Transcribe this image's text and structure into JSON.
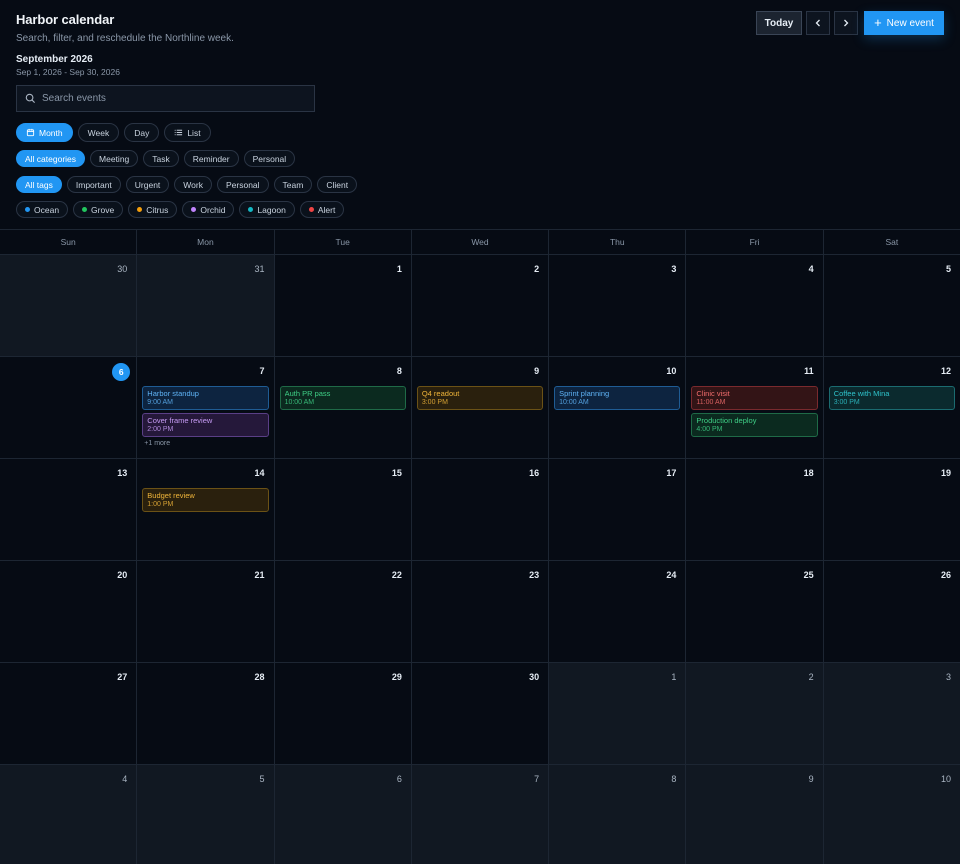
{
  "header": {
    "title": "Harbor calendar",
    "subtitle": "Search, filter, and reschedule the Northline week.",
    "month_title": "September 2026",
    "month_range": "Sep 1, 2026 - Sep 30, 2026"
  },
  "toolbar": {
    "today_label": "Today",
    "new_event_label": "New event"
  },
  "search": {
    "placeholder": "Search events",
    "value": ""
  },
  "views": [
    {
      "label": "Month",
      "active": true,
      "icon": "calendar-icon"
    },
    {
      "label": "Week",
      "active": false
    },
    {
      "label": "Day",
      "active": false
    },
    {
      "label": "List",
      "active": false,
      "icon": "list-icon"
    }
  ],
  "categories": [
    {
      "label": "All categories",
      "active": true
    },
    {
      "label": "Meeting",
      "active": false
    },
    {
      "label": "Task",
      "active": false
    },
    {
      "label": "Reminder",
      "active": false
    },
    {
      "label": "Personal",
      "active": false
    }
  ],
  "tags": [
    {
      "label": "All tags",
      "active": true
    },
    {
      "label": "Important",
      "active": false
    },
    {
      "label": "Urgent",
      "active": false
    },
    {
      "label": "Work",
      "active": false
    },
    {
      "label": "Personal",
      "active": false
    },
    {
      "label": "Team",
      "active": false
    },
    {
      "label": "Client",
      "active": false
    }
  ],
  "colors": [
    {
      "label": "Ocean",
      "color": "#2196f3"
    },
    {
      "label": "Grove",
      "color": "#22c55e"
    },
    {
      "label": "Citrus",
      "color": "#f59e0b"
    },
    {
      "label": "Orchid",
      "color": "#c084fc"
    },
    {
      "label": "Lagoon",
      "color": "#14b8c4"
    },
    {
      "label": "Alert",
      "color": "#ef4444"
    }
  ],
  "weekdays": [
    "Sun",
    "Mon",
    "Tue",
    "Wed",
    "Thu",
    "Fri",
    "Sat"
  ],
  "palette": {
    "ocean": {
      "bg": "#0d2440",
      "border": "#1f5c94",
      "text": "#5fb3f5"
    },
    "grove": {
      "bg": "#0b2a1f",
      "border": "#1f6a47",
      "text": "#3fcf86"
    },
    "citrus": {
      "bg": "#2a200d",
      "border": "#6b5216",
      "text": "#f0b53a"
    },
    "orchid": {
      "bg": "#25183a",
      "border": "#5a3f86",
      "text": "#c79cf5"
    },
    "lagoon": {
      "bg": "#0b2a2e",
      "border": "#1b6b70",
      "text": "#2fc4cc"
    },
    "alert": {
      "bg": "#331416",
      "border": "#7a2a2e",
      "text": "#f26d6d"
    }
  },
  "weeks": [
    [
      {
        "num": "30",
        "outside": true
      },
      {
        "num": "31",
        "outside": true
      },
      {
        "num": "1"
      },
      {
        "num": "2"
      },
      {
        "num": "3"
      },
      {
        "num": "4"
      },
      {
        "num": "5"
      }
    ],
    [
      {
        "num": "6",
        "today": true
      },
      {
        "num": "7",
        "events": [
          {
            "title": "Harbor standup",
            "time": "9:00 AM",
            "color": "ocean"
          },
          {
            "title": "Cover frame review",
            "time": "2:00 PM",
            "color": "orchid"
          }
        ],
        "more": "+1 more"
      },
      {
        "num": "8",
        "events": [
          {
            "title": "Auth PR pass",
            "time": "10:00 AM",
            "color": "grove"
          }
        ]
      },
      {
        "num": "9",
        "events": [
          {
            "title": "Q4 readout",
            "time": "3:00 PM",
            "color": "citrus"
          }
        ]
      },
      {
        "num": "10",
        "events": [
          {
            "title": "Sprint planning",
            "time": "10:00 AM",
            "color": "ocean"
          }
        ]
      },
      {
        "num": "11",
        "events": [
          {
            "title": "Clinic visit",
            "time": "11:00 AM",
            "color": "alert"
          },
          {
            "title": "Production deploy",
            "time": "4:00 PM",
            "color": "grove"
          }
        ]
      },
      {
        "num": "12",
        "events": [
          {
            "title": "Coffee with Mina",
            "time": "3:00 PM",
            "color": "lagoon"
          }
        ]
      }
    ],
    [
      {
        "num": "13"
      },
      {
        "num": "14",
        "events": [
          {
            "title": "Budget review",
            "time": "1:00 PM",
            "color": "citrus"
          }
        ]
      },
      {
        "num": "15"
      },
      {
        "num": "16"
      },
      {
        "num": "17"
      },
      {
        "num": "18"
      },
      {
        "num": "19"
      }
    ],
    [
      {
        "num": "20"
      },
      {
        "num": "21"
      },
      {
        "num": "22"
      },
      {
        "num": "23"
      },
      {
        "num": "24"
      },
      {
        "num": "25"
      },
      {
        "num": "26"
      }
    ],
    [
      {
        "num": "27"
      },
      {
        "num": "28"
      },
      {
        "num": "29"
      },
      {
        "num": "30"
      },
      {
        "num": "1",
        "outside": true
      },
      {
        "num": "2",
        "outside": true
      },
      {
        "num": "3",
        "outside": true
      }
    ],
    [
      {
        "num": "4",
        "outside": true
      },
      {
        "num": "5",
        "outside": true
      },
      {
        "num": "6",
        "outside": true
      },
      {
        "num": "7",
        "outside": true
      },
      {
        "num": "8",
        "outside": true
      },
      {
        "num": "9",
        "outside": true
      },
      {
        "num": "10",
        "outside": true
      }
    ]
  ]
}
